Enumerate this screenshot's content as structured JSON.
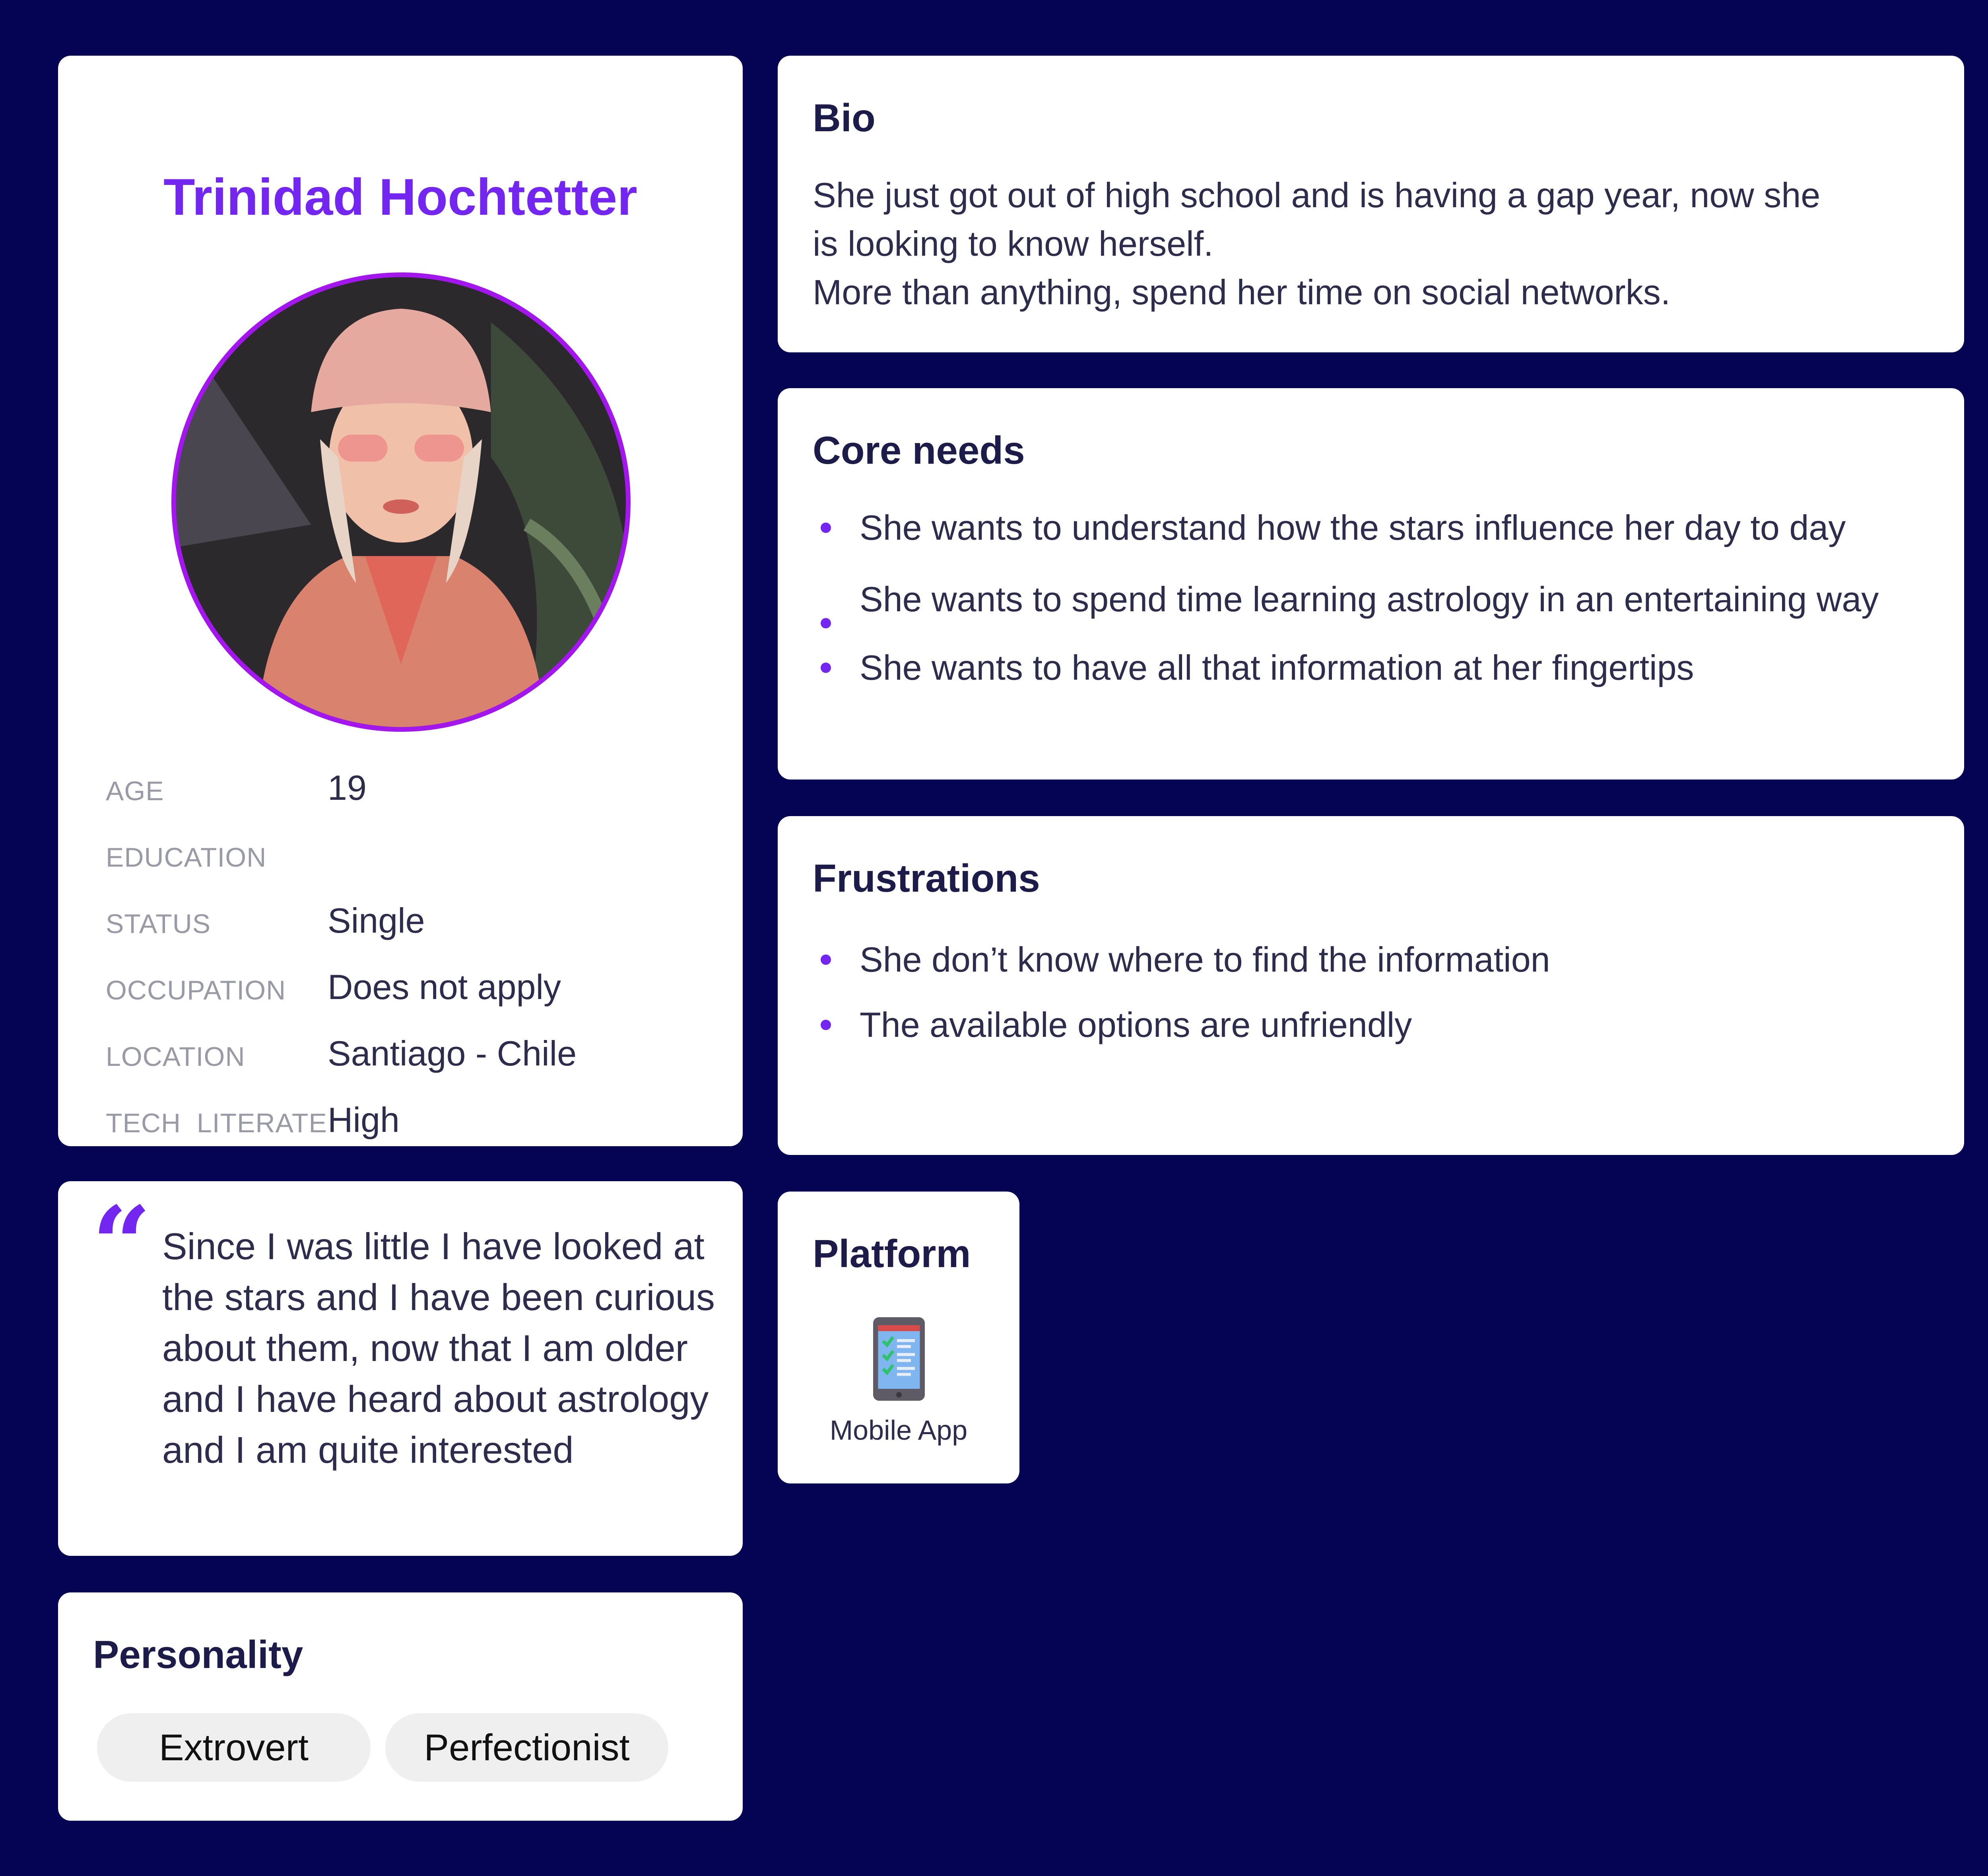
{
  "profile": {
    "name": "Trinidad Hochtetter",
    "facts": [
      {
        "label": "AGE",
        "value": "19"
      },
      {
        "label": "EDUCATION",
        "value": ""
      },
      {
        "label": "STATUS",
        "value": "Single"
      },
      {
        "label": "OCCUPATION",
        "value": "Does not apply"
      },
      {
        "label": "LOCATION",
        "value": "Santiago - Chile"
      },
      {
        "label": "TECH  LITERATE",
        "value": "High"
      }
    ]
  },
  "quote": {
    "mark": "“",
    "text": "Since I was little I have looked at the stars and I have been curious about them, now that I am older and I have heard about astrology and I am quite interested"
  },
  "personality": {
    "title": "Personality",
    "traits": [
      "Extrovert",
      "Perfectionist"
    ]
  },
  "bio": {
    "title": "Bio",
    "lines": [
      "She just got out of high school and is having a gap year, now she",
      "is looking to know herself.",
      "More than anything, spend her time on social networks."
    ]
  },
  "core_needs": {
    "title": "Core needs",
    "items": [
      "She wants to understand how the stars influence her day to day",
      "She wants to spend time learning astrology in an entertaining way",
      "She wants to have all that information at her fingertips"
    ]
  },
  "frustrations": {
    "title": "Frustrations",
    "items": [
      "She don’t know where to find the information",
      "The available options are unfriendly"
    ]
  },
  "platform": {
    "title": "Platform",
    "icon": "mobile-app-icon",
    "label": "Mobile App"
  },
  "colors": {
    "background": "#050354",
    "accent": "#7326f0",
    "avatar_ring": "#a317ee",
    "heading": "#1c1b4a",
    "text": "#2e2c4d"
  }
}
